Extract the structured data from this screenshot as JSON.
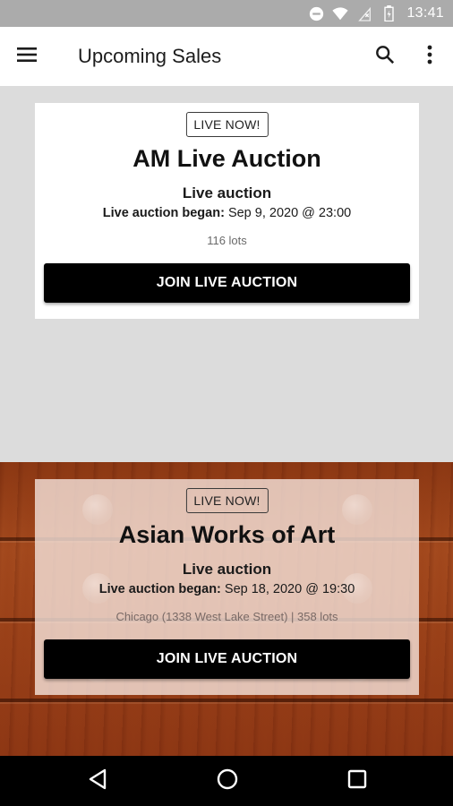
{
  "status_bar": {
    "time": "13:41",
    "icons": [
      "do-not-disturb-icon",
      "wifi-icon",
      "signal-icon",
      "battery-icon"
    ]
  },
  "app_bar": {
    "title": "Upcoming Sales",
    "icons": [
      "menu-icon",
      "search-icon",
      "more-vert-icon"
    ]
  },
  "sales": [
    {
      "badge": "LIVE NOW!",
      "title": "AM Live Auction",
      "type": "Live auction",
      "began_label": "Live auction began:",
      "began_value": " Sep 9, 2020 @ 23:00",
      "meta": "116 lots",
      "button_label": "JOIN LIVE AUCTION"
    },
    {
      "badge": "LIVE NOW!",
      "title": "Asian Works of Art",
      "type": "Live auction",
      "began_label": "Live auction began:",
      "began_value": " Sep 18, 2020 @ 19:30",
      "meta": "Chicago (1338 West Lake Street)  |  358 lots",
      "button_label": "JOIN LIVE AUCTION"
    }
  ],
  "nav_bar": {
    "icons": [
      "back-icon",
      "home-icon",
      "recents-icon"
    ]
  },
  "colors": {
    "status_bar": "#ababab",
    "app_bar": "#ffffff",
    "background": "#dcdcdc",
    "button": "#000000",
    "nav_bar": "#000000"
  }
}
